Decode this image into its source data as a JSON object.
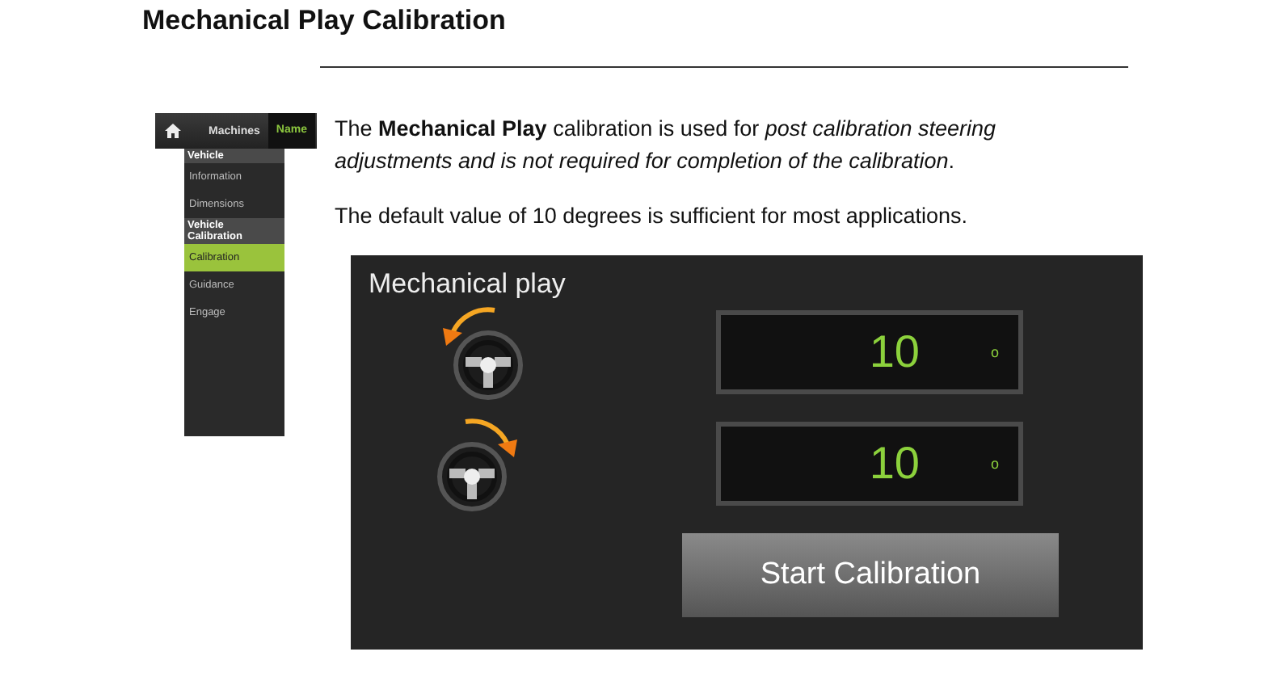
{
  "heading": "Mechanical Play Calibration",
  "sidebar": {
    "breadcrumb": [
      {
        "label": "Machines",
        "selected": false
      },
      {
        "label": "Name",
        "selected": true
      }
    ],
    "sections": [
      {
        "title": "Vehicle",
        "items": [
          {
            "label": "Information",
            "selected": false
          },
          {
            "label": "Dimensions",
            "selected": false
          }
        ]
      },
      {
        "title": "Vehicle Calibration",
        "items": [
          {
            "label": "Calibration",
            "selected": true
          },
          {
            "label": "Guidance",
            "selected": false
          },
          {
            "label": "Engage",
            "selected": false
          }
        ]
      }
    ]
  },
  "paragraphs": [
    "The **Mechanical Play** calibration is used for *post calibration steering adjustments and is not required for completion of the calibration*.",
    "The default value of 10 degrees is sufficient for most applications."
  ],
  "panel": {
    "title": "Mechanical play",
    "rows": [
      {
        "kind": "left",
        "value": "10",
        "unit": "o"
      },
      {
        "kind": "right",
        "value": "10",
        "unit": "o"
      }
    ],
    "button": "Start Calibration"
  }
}
